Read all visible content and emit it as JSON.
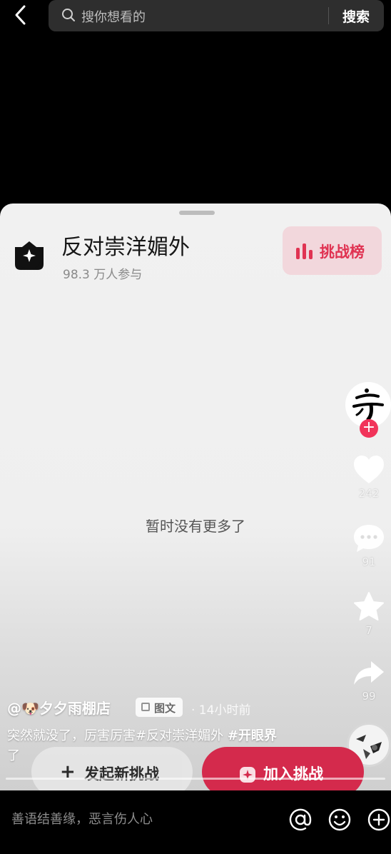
{
  "search": {
    "placeholder": "搜你想看的",
    "button": "搜索"
  },
  "challenge": {
    "title": "反对崇洋媚外",
    "participants": "98.3 万人参与",
    "rank_button": "挑战榜"
  },
  "empty_text": "暂时没有更多了",
  "actions": {
    "likes": "242",
    "comments": "91",
    "favorites": "7",
    "shares": "99"
  },
  "post": {
    "author": "@🐶夕夕雨棚店",
    "tag": "图文",
    "time": "· 14小时前",
    "caption_plain": "突然就没了，厉害厉害#反对崇洋媚外 ",
    "caption_bold": "#开眼界",
    "caption_tail": "了"
  },
  "buttons": {
    "new_challenge": "发起新挑战",
    "join_challenge": "加入挑战"
  },
  "comment_bar": {
    "placeholder": "善语结善缘，恶言伤人心"
  },
  "colors": {
    "accent": "#d42a4c",
    "rank_text": "#e03352",
    "follow": "#f1345a"
  },
  "progress": 0
}
